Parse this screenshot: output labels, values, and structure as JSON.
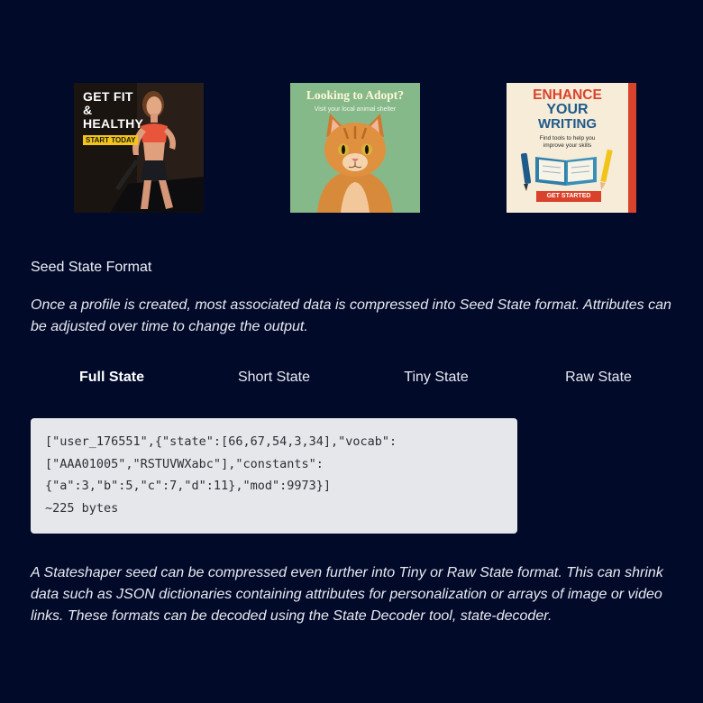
{
  "ads": [
    {
      "name": "fitness",
      "lines": [
        "GET FIT",
        "&",
        "HEALTHY"
      ],
      "cta": "START TODAY"
    },
    {
      "name": "adopt",
      "title": "Looking to Adopt?",
      "subtitle": "Visit your local animal shelter"
    },
    {
      "name": "writing",
      "title_lines": [
        "ENHANCE",
        "YOUR",
        "WRITING"
      ],
      "subtitle_lines": [
        "Find tools to help you",
        "improve your skills"
      ],
      "cta": "GET STARTED"
    }
  ],
  "section": {
    "title": "Seed State Format",
    "intro": "Once a profile is created, most associated data is compressed into Seed State format. Attributes can be adjusted over time to change the output."
  },
  "tabs": [
    {
      "label": "Full State",
      "active": true
    },
    {
      "label": "Short State",
      "active": false
    },
    {
      "label": "Tiny State",
      "active": false
    },
    {
      "label": "Raw State",
      "active": false
    }
  ],
  "code": {
    "lines": [
      "[\"user_176551\",{\"state\":[66,67,54,3,34],\"vocab\":",
      "[\"AAA01005\",\"RSTUVWXabc\"],\"constants\":",
      "{\"a\":3,\"b\":5,\"c\":7,\"d\":11},\"mod\":9973}]"
    ],
    "size": "~225 bytes"
  },
  "outro": "A Stateshaper seed can be compressed even further into Tiny or Raw State format. This can shrink data such as JSON dictionaries containing attributes for personalization or arrays of image or video links. These formats can be decoded using the State Decoder tool, state-decoder.",
  "colors": {
    "background": "#020a2a",
    "code_bg": "#e6e7ea",
    "accent_red": "#d9432c",
    "accent_yellow": "#f2c41a"
  }
}
